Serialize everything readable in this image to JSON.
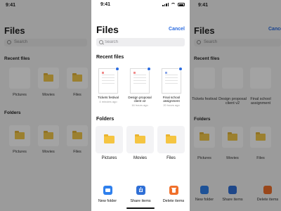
{
  "status": {
    "time": "9:41"
  },
  "header": {
    "title": "Files",
    "cancel_label": "Cancel"
  },
  "search": {
    "placeholder": "Search"
  },
  "recent": {
    "heading": "Recent files",
    "items": [
      {
        "name": "Tickets festival",
        "time": "4 minutes ago"
      },
      {
        "name": "Design proposal client v2",
        "time": "16 hours ago"
      },
      {
        "name": "Final school assignment",
        "time": "20 hours ago"
      }
    ]
  },
  "folders": {
    "heading": "Folders",
    "items": [
      {
        "name": "Pictures"
      },
      {
        "name": "Movies"
      },
      {
        "name": "Files"
      }
    ]
  },
  "actions": [
    {
      "label": "New folder",
      "icon": "new-folder-icon",
      "color": "#2f80ed"
    },
    {
      "label": "Share items",
      "icon": "share-icon",
      "color": "#2f6fd6"
    },
    {
      "label": "Delete items",
      "icon": "trash-icon",
      "color": "#f0702b"
    }
  ],
  "colors": {
    "accent": "#2a6be0",
    "folder": "#f5c542"
  }
}
